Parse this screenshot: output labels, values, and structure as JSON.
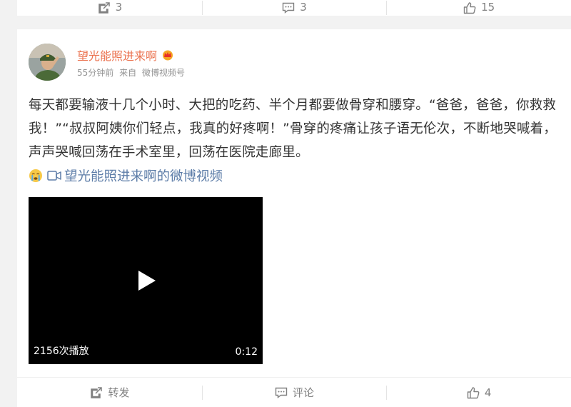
{
  "top_bar": {
    "repost_count": "3",
    "comment_count": "3",
    "like_count": "15"
  },
  "post": {
    "username": "望光能照进来啊",
    "time": "55分钟前",
    "source_prefix": "来自",
    "source": "微博视频号",
    "text": "每天都要输液十几个小时、大把的吃药、半个月都要做骨穿和腰穿。“爸爸，爸爸，你救救我！”“叔叔阿姨你们轻点，我真的好疼啊！”骨穿的疼痛让孩子语无伦次，不断地哭喊着，声声哭喊回荡在手术室里，回荡在医院走廊里。",
    "video_link_label": "望光能照进来啊的微博视频",
    "video": {
      "play_count": "2156次播放",
      "duration": "0:12"
    },
    "actions": {
      "repost_label": "转发",
      "comment_label": "评论",
      "like_count": "4"
    }
  },
  "colors": {
    "accent_orange": "#eb7350",
    "link_blue": "#5d7da8",
    "icon_gray": "#808080"
  },
  "icons": [
    "repost-icon",
    "comment-icon",
    "like-icon",
    "vip-crown-icon",
    "crying-emoji-icon",
    "video-icon",
    "play-icon"
  ]
}
